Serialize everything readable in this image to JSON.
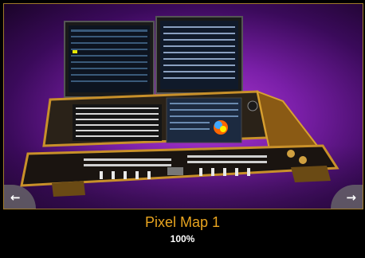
{
  "item": {
    "title": "Pixel Map 1",
    "percent": "100%"
  },
  "nav": {
    "prev_icon": "arrow-left-icon",
    "next_icon": "arrow-right-icon"
  },
  "colors": {
    "accent": "#e8a41f",
    "frame_border": "#a07a2a",
    "background": "#000000"
  }
}
